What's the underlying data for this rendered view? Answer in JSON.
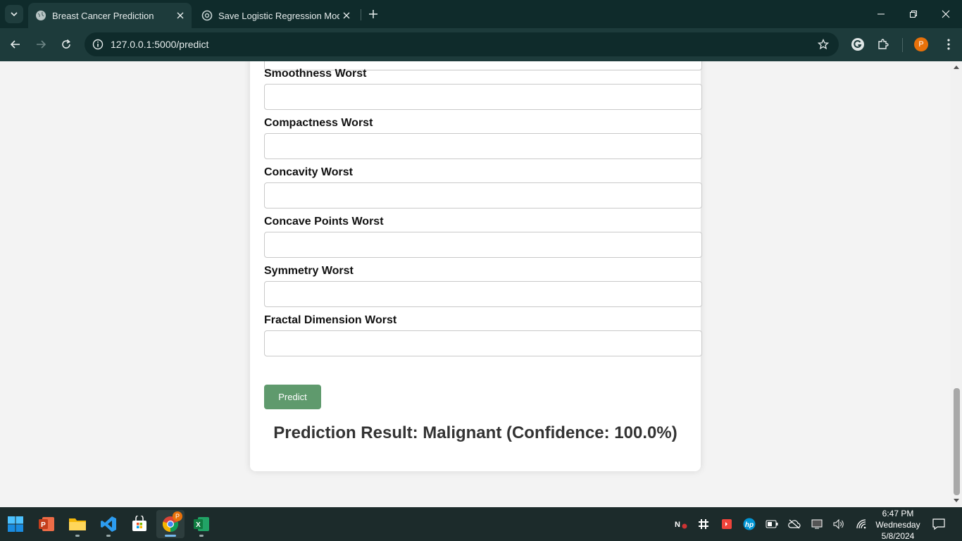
{
  "browser": {
    "tabs": [
      {
        "title": "Breast Cancer Prediction",
        "active": true,
        "icon": "globe-icon"
      },
      {
        "title": "Save Logistic Regression Model",
        "active": false,
        "icon": "chatgpt-icon"
      }
    ],
    "url": "127.0.0.1:5000/predict",
    "profile_initial": "P",
    "accent_color": "#1d3b3b"
  },
  "form": {
    "fields": [
      {
        "label": "Smoothness Worst",
        "value": ""
      },
      {
        "label": "Compactness Worst",
        "value": ""
      },
      {
        "label": "Concavity Worst",
        "value": ""
      },
      {
        "label": "Concave Points Worst",
        "value": ""
      },
      {
        "label": "Symmetry Worst",
        "value": ""
      },
      {
        "label": "Fractal Dimension Worst",
        "value": ""
      }
    ],
    "predict_label": "Predict",
    "button_color": "#5f9a6d"
  },
  "result": {
    "text": "Prediction Result: Malignant (Confidence: 100.0%)"
  },
  "taskbar": {
    "apps": [
      "start-icon",
      "powerpoint-icon",
      "file-explorer-icon",
      "vscode-icon",
      "store-icon",
      "chrome-icon",
      "excel-icon"
    ],
    "chrome_badge": "P",
    "time": "6:47 PM",
    "day": "Wednesday",
    "date": "5/8/2024"
  }
}
